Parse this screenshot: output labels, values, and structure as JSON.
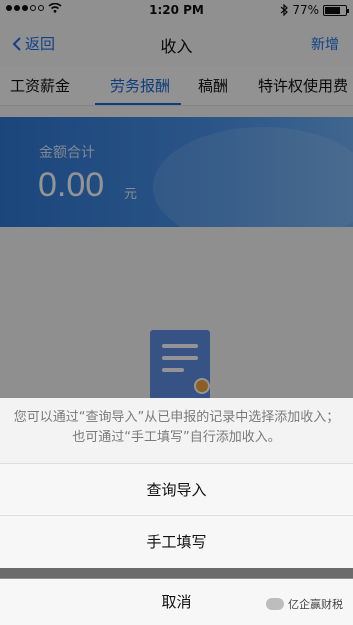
{
  "status_bar": {
    "time": "1:20 PM",
    "battery_percent": "77%",
    "battery_level": 0.77,
    "icons": [
      "signal-dots-icon",
      "wifi-icon",
      "bluetooth-icon",
      "battery-icon"
    ]
  },
  "nav": {
    "back_label": "返回",
    "title": "收入",
    "new_label": "新增"
  },
  "tabs": [
    {
      "label": "工资薪金",
      "active": false
    },
    {
      "label": "劳务报酬",
      "active": true
    },
    {
      "label": "稿酬",
      "active": false
    },
    {
      "label": "特许权使用费",
      "active": false
    }
  ],
  "summary": {
    "label": "金额合计",
    "amount": "0.00",
    "unit": "元"
  },
  "action_sheet": {
    "message": "您可以通过“查询导入”从已申报的记录中选择添加收入；也可通过“手工填写”自行添加收入。",
    "options": [
      "查询导入",
      "手工填写"
    ],
    "cancel_label": "取消"
  },
  "watermark": {
    "text": "亿企赢财税"
  },
  "colors": {
    "accent": "#1a6ad6",
    "banner_start": "#2f79d6",
    "banner_end": "#6fb0f5"
  }
}
